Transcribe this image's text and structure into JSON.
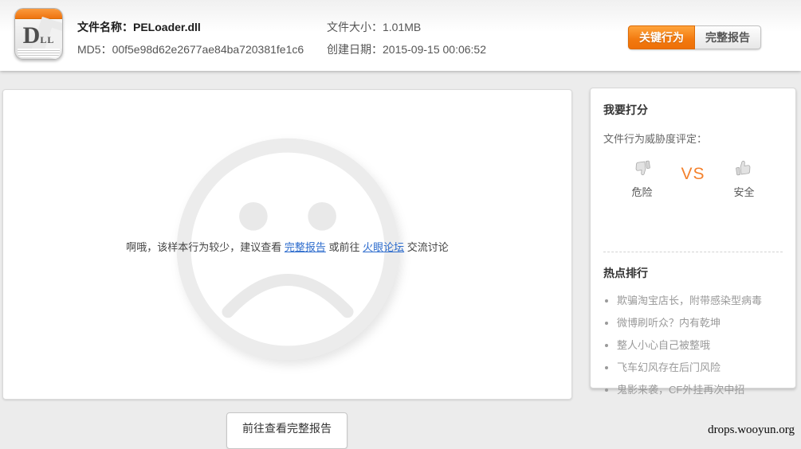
{
  "header": {
    "icon": {
      "name": "dll-file-icon",
      "letter_main": "D",
      "letter_sub": "LL"
    },
    "file_name_label": "文件名称：",
    "file_name": "PELoader.dll",
    "md5_label": "MD5：",
    "md5": "00f5e98d62e2677ae84ba720381fe1c6",
    "file_size_label": "文件大小：",
    "file_size": "1.01MB",
    "created_label": "创建日期：",
    "created": "2015-09-15 00:06:52",
    "btn_key_behavior": "关键行为",
    "btn_full_report": "完整报告"
  },
  "main": {
    "face_icon": "sad-face-icon",
    "message_prefix": "啊哦，该样本行为较少，建议查看 ",
    "link_full_report": "完整报告",
    "message_middle": " 或前往 ",
    "link_forum": "火眼论坛",
    "message_suffix": " 交流讨论"
  },
  "sidebar": {
    "rate_title": "我要打分",
    "rate_subtitle": "文件行为威胁度评定：",
    "danger_label": "危险",
    "vs_label": "VS",
    "safe_label": "安全",
    "icons": {
      "danger": "thumb-down-icon",
      "safe": "thumb-up-icon"
    },
    "hot_title": "热点排行",
    "hot_items": [
      "欺骗淘宝店长，附带感染型病毒",
      "微博刷听众？内有乾坤",
      "整人小心自己被整哦",
      "飞车幻风存在后门风险",
      "鬼影来袭，CF外挂再次中招"
    ]
  },
  "footer": {
    "goto_report_button": "前往查看完整报告",
    "watermark": "drops.wooyun.org"
  },
  "colors": {
    "accent_orange": "#ee7008",
    "vs_orange": "#f4812c",
    "link_blue": "#2d6ccd",
    "page_bg": "#ececec"
  }
}
